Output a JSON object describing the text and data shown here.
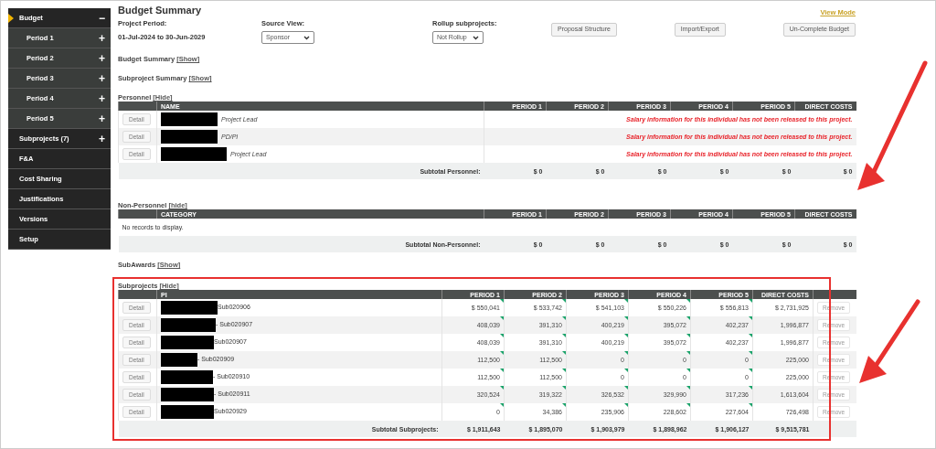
{
  "sidebar": {
    "items": [
      {
        "label": "Budget",
        "selected": true,
        "toggle_icon": "−",
        "children": [
          {
            "label": "Period 1",
            "toggle_icon": "+"
          },
          {
            "label": "Period 2",
            "toggle_icon": "+"
          },
          {
            "label": "Period 3",
            "toggle_icon": "+"
          },
          {
            "label": "Period 4",
            "toggle_icon": "+"
          },
          {
            "label": "Period 5",
            "toggle_icon": "+"
          }
        ]
      },
      {
        "label": "Subprojects (7)",
        "selected": false,
        "toggle_icon": "+"
      },
      {
        "label": "F&A",
        "selected": false
      },
      {
        "label": "Cost Sharing",
        "selected": false
      },
      {
        "label": "Justifications",
        "selected": false
      },
      {
        "label": "Versions",
        "selected": false
      },
      {
        "label": "Setup",
        "selected": false
      }
    ]
  },
  "title": "Budget Summary",
  "mode": "View Mode",
  "project_period": {
    "label": "Project Period:",
    "value": "01-Jul-2024 to 30-Jun-2029"
  },
  "source_view": {
    "label": "Source View:",
    "value": "Sponsor"
  },
  "rollup": {
    "label": "Rollup subprojects:",
    "value": "Not Rollup"
  },
  "buttons": [
    "Proposal Structure",
    "Import/Export",
    "Un-Complete Budget"
  ],
  "collapsed_sections": [
    {
      "label": "Budget Summary",
      "toggle": "[Show]"
    },
    {
      "label": "Subproject Summary",
      "toggle": "[Show]"
    }
  ],
  "personnel": {
    "label": "Personnel",
    "toggle": "[Hide]",
    "columns": [
      "NAME",
      "PERIOD 1",
      "PERIOD 2",
      "PERIOD 3",
      "PERIOD 4",
      "PERIOD 5",
      "DIRECT COSTS"
    ],
    "rows": [
      {
        "button": "Detail",
        "role": "Project Lead",
        "message": "Salary information for this individual has not been released to this project."
      },
      {
        "button": "Detail",
        "role": "PD/PI",
        "message": "Salary information for this individual has not been released to this project."
      },
      {
        "button": "Detail",
        "role": "Project Lead",
        "message": "Salary information for this individual has not been released to this project."
      }
    ],
    "subtotal": {
      "label": "Subtotal Personnel:",
      "values": [
        "$ 0",
        "$ 0",
        "$ 0",
        "$ 0",
        "$ 0",
        "$ 0"
      ]
    }
  },
  "non_personnel": {
    "label": "Non-Personnel",
    "toggle": "[hide]",
    "columns": [
      "CATEGORY",
      "PERIOD 1",
      "PERIOD 2",
      "PERIOD 3",
      "PERIOD 4",
      "PERIOD 5",
      "DIRECT COSTS"
    ],
    "empty": "No records to display.",
    "subtotal": {
      "label": "Subtotal Non-Personnel:",
      "values": [
        "$ 0",
        "$ 0",
        "$ 0",
        "$ 0",
        "$ 0",
        "$ 0"
      ]
    }
  },
  "subawards": {
    "label": "SubAwards",
    "toggle": "[Show]"
  },
  "subprojects": {
    "label": "Subprojects",
    "toggle": "[Hide]",
    "columns": [
      "PI",
      "PERIOD 1",
      "PERIOD 2",
      "PERIOD 3",
      "PERIOD 4",
      "PERIOD 5",
      "DIRECT COSTS"
    ],
    "rows": [
      {
        "button": "Detail",
        "code": "Sub020906",
        "values": [
          "$ 550,041",
          "$ 533,742",
          "$ 541,103",
          "$ 550,226",
          "$ 556,813",
          "$ 2,731,925"
        ],
        "action": "Remove",
        "disabled": true
      },
      {
        "button": "Detail",
        "code": "- Sub020907",
        "values": [
          "408,039",
          "391,310",
          "400,219",
          "395,072",
          "402,237",
          "1,996,877"
        ],
        "action": "Remove",
        "disabled": true
      },
      {
        "button": "Detail",
        "code": "Sub020907",
        "values": [
          "408,039",
          "391,310",
          "400,219",
          "395,072",
          "402,237",
          "1,996,877"
        ],
        "action": "Remove",
        "disabled": true
      },
      {
        "button": "Detail",
        "code": "- Sub020909",
        "values": [
          "112,500",
          "112,500",
          "0",
          "0",
          "0",
          "225,000"
        ],
        "action": "Remove",
        "disabled": true
      },
      {
        "button": "Detail",
        "code": "- Sub020910",
        "values": [
          "112,500",
          "112,500",
          "0",
          "0",
          "0",
          "225,000"
        ],
        "action": "Remove",
        "disabled": true
      },
      {
        "button": "Detail",
        "code": "- Sub020911",
        "values": [
          "320,524",
          "319,322",
          "326,532",
          "329,990",
          "317,236",
          "1,613,604"
        ],
        "action": "Remove",
        "disabled": true
      },
      {
        "button": "Detail",
        "code": "Sub020929",
        "values": [
          "0",
          "34,386",
          "235,906",
          "228,602",
          "227,604",
          "726,498"
        ],
        "action": "Remove",
        "disabled": true
      }
    ],
    "subtotal": {
      "label": "Subtotal Subprojects:",
      "values": [
        "$ 1,911,643",
        "$ 1,895,070",
        "$ 1,903,979",
        "$ 1,898,962",
        "$ 1,906,127",
        "$ 9,515,781"
      ]
    }
  },
  "annotations": [
    {
      "kind": "arrow"
    },
    {
      "kind": "arrow"
    },
    {
      "kind": "frame"
    }
  ]
}
